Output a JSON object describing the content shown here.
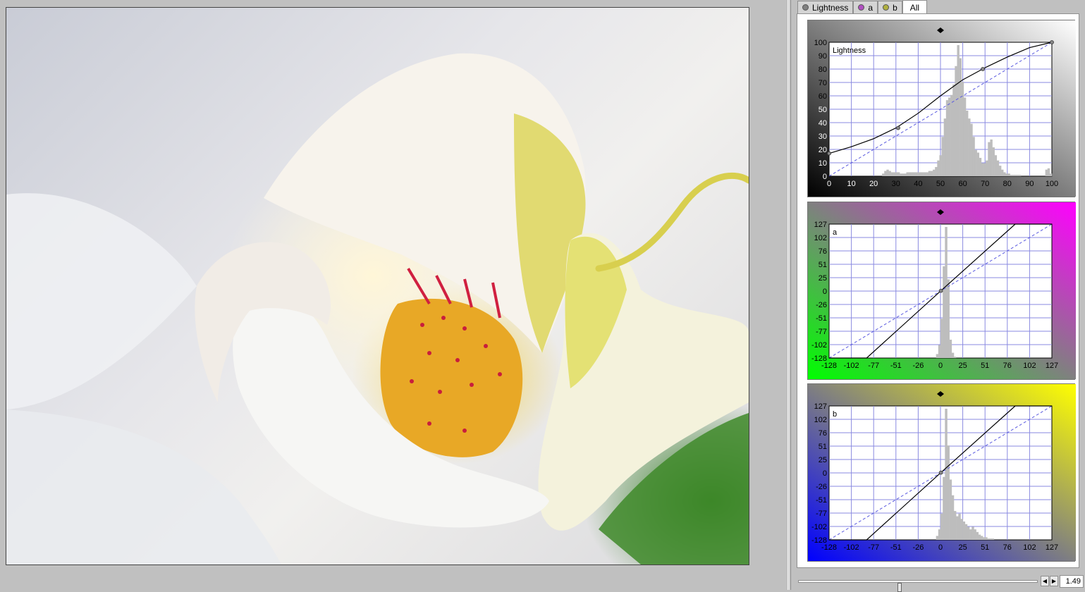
{
  "tabs": [
    {
      "label": "Lightness",
      "icon": "lightness-sphere-icon",
      "dot_color": "#808080"
    },
    {
      "label": "a",
      "icon": "a-channel-sphere-icon",
      "dot_color": "#b050c0"
    },
    {
      "label": "b",
      "icon": "b-channel-sphere-icon",
      "dot_color": "#b0b040"
    },
    {
      "label": "All",
      "active": true
    }
  ],
  "curves": [
    {
      "channel": "Lightness",
      "frame_colors": [
        "#000000",
        "#ffffff"
      ],
      "y_ticks": [
        "100",
        "90",
        "80",
        "70",
        "60",
        "50",
        "40",
        "30",
        "20",
        "10",
        "0"
      ],
      "x_ticks": [
        "0",
        "10",
        "20",
        "30",
        "40",
        "50",
        "60",
        "70",
        "80",
        "90",
        "100"
      ],
      "range": [
        0,
        100
      ],
      "curve_points": [
        [
          0,
          17
        ],
        [
          10,
          22
        ],
        [
          20,
          28
        ],
        [
          30,
          36
        ],
        [
          40,
          47
        ],
        [
          50,
          60
        ],
        [
          60,
          72
        ],
        [
          70,
          81
        ],
        [
          80,
          89
        ],
        [
          90,
          96
        ],
        [
          100,
          100
        ]
      ],
      "control_points": [
        [
          0,
          17
        ],
        [
          31,
          36
        ],
        [
          69,
          80
        ],
        [
          100,
          100
        ]
      ],
      "histogram": {
        "bins": [
          0,
          0,
          0,
          0,
          0,
          0,
          0,
          0,
          0,
          0,
          0,
          0,
          0,
          0,
          0,
          0,
          0,
          0,
          0,
          0,
          0,
          0,
          0,
          0,
          2,
          4,
          5,
          4,
          3,
          3,
          3,
          3,
          2,
          2,
          2,
          3,
          3,
          3,
          3,
          3,
          3,
          3,
          3,
          3,
          3,
          4,
          4,
          5,
          7,
          12,
          16,
          30,
          44,
          58,
          60,
          62,
          70,
          84,
          100,
          90,
          72,
          60,
          50,
          44,
          40,
          30,
          20,
          18,
          14,
          10,
          10,
          12,
          26,
          28,
          22,
          16,
          12,
          8,
          5,
          3,
          2,
          2,
          1,
          1,
          1,
          1,
          1,
          0,
          0,
          0,
          0,
          0,
          0,
          0,
          0,
          0,
          0,
          0,
          5,
          6,
          2
        ]
      }
    },
    {
      "channel": "a",
      "frame_colors": [
        "#00ff00",
        "#ff00ff"
      ],
      "y_ticks": [
        "127",
        "102",
        "76",
        "51",
        "25",
        "0",
        "-26",
        "-51",
        "-77",
        "-102",
        "-128"
      ],
      "x_ticks": [
        "-128",
        "-102",
        "-77",
        "-51",
        "-26",
        "0",
        "25",
        "51",
        "76",
        "102",
        "127"
      ],
      "range": [
        -128,
        127
      ],
      "curve_points": [
        [
          -128,
          -128
        ],
        [
          -85,
          -128
        ],
        [
          0,
          0
        ],
        [
          85,
          127
        ],
        [
          127,
          127
        ]
      ],
      "control_points": [
        [
          0,
          0
        ]
      ],
      "histogram": {
        "bins": [
          0,
          0,
          0,
          0,
          0,
          0,
          0,
          0,
          0,
          0,
          0,
          0,
          0,
          0,
          0,
          0,
          0,
          0,
          0,
          0,
          0,
          0,
          0,
          0,
          0,
          0,
          0,
          0,
          0,
          0,
          0,
          0,
          0,
          0,
          0,
          0,
          0,
          0,
          0,
          0,
          0,
          0,
          0,
          0,
          0,
          0,
          0,
          0,
          3,
          10,
          30,
          70,
          100,
          60,
          14,
          4,
          1,
          0,
          0,
          0,
          0,
          0,
          0,
          0,
          0,
          0,
          0,
          0,
          0,
          0,
          0,
          0,
          0,
          0,
          0,
          0,
          0,
          0,
          0,
          0,
          0,
          0,
          0,
          0,
          0,
          0,
          0,
          0,
          0,
          0,
          0,
          0,
          0,
          0,
          0,
          0,
          0,
          0,
          0,
          0
        ]
      }
    },
    {
      "channel": "b",
      "frame_colors": [
        "#0000ff",
        "#ffff00"
      ],
      "y_ticks": [
        "127",
        "102",
        "76",
        "51",
        "25",
        "0",
        "-26",
        "-51",
        "-77",
        "-102",
        "-128"
      ],
      "x_ticks": [
        "-128",
        "-102",
        "-77",
        "-51",
        "-26",
        "0",
        "25",
        "51",
        "76",
        "102",
        "127"
      ],
      "range": [
        -128,
        127
      ],
      "curve_points": [
        [
          -128,
          -128
        ],
        [
          -85,
          -128
        ],
        [
          0,
          0
        ],
        [
          85,
          127
        ],
        [
          127,
          127
        ]
      ],
      "control_points": [
        [
          0,
          0
        ]
      ],
      "histogram": {
        "bins": [
          0,
          0,
          0,
          0,
          0,
          0,
          0,
          0,
          0,
          0,
          0,
          0,
          0,
          0,
          0,
          0,
          0,
          0,
          0,
          0,
          0,
          0,
          0,
          0,
          0,
          0,
          0,
          0,
          0,
          0,
          0,
          0,
          0,
          0,
          0,
          0,
          0,
          0,
          0,
          0,
          0,
          0,
          0,
          0,
          0,
          0,
          0,
          0,
          3,
          8,
          20,
          48,
          100,
          72,
          46,
          34,
          22,
          18,
          20,
          16,
          14,
          12,
          10,
          8,
          10,
          8,
          6,
          4,
          3,
          2,
          2,
          1,
          1,
          1,
          0,
          0,
          0,
          0,
          0,
          0,
          0,
          0,
          0,
          0,
          0,
          0,
          0,
          0,
          0,
          0,
          0,
          0,
          0,
          0,
          0,
          0,
          0,
          0,
          0,
          0
        ]
      }
    }
  ],
  "zoom": {
    "value": "1.49",
    "slider_fraction": 0.42
  }
}
